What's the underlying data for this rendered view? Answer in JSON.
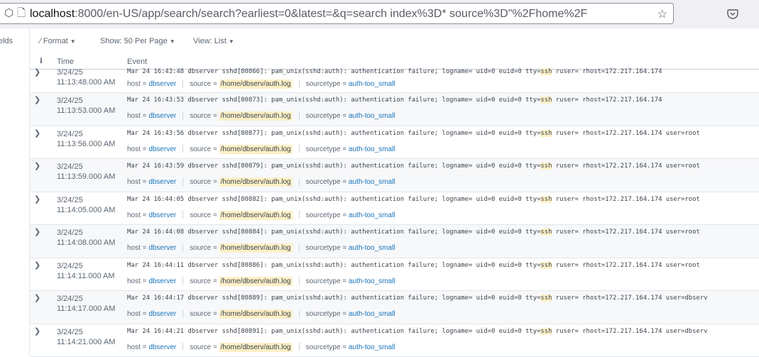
{
  "browser": {
    "url_host": "localhost",
    "url_rest": ":8000/en-US/app/search/search?earliest=0&latest=&q=search index%3D* source%3D\"%2Fhome%2F",
    "icons": [
      "shield-icon",
      "page-icon",
      "star-icon",
      "pocket-icon"
    ]
  },
  "toolbar": {
    "fields_label": "elds",
    "format_label": "Format",
    "show_label": "Show: 50 Per Page",
    "view_label": "View: List"
  },
  "table": {
    "col_info": "i",
    "col_time": "Time",
    "col_event": "Event",
    "field_keys": {
      "host": "host =",
      "source": "source =",
      "sourcetype": "sourcetype ="
    },
    "rows": [
      {
        "date": "3/24/25",
        "time": "11:13:48.000 AM",
        "pre": "Mar 24 16:43:48 dbserver sshd[80866]: pam_unix(sshd:auth): authentication failure; logname= uid=0 euid=0 tty=",
        "hl": "ssh",
        "post": " ruser= rhost=172.217.164.174",
        "host": "dbserver",
        "source": "/home/dbserv/auth.log",
        "sourcetype": "auth-too_small"
      },
      {
        "date": "3/24/25",
        "time": "11:13:53.000 AM",
        "pre": "Mar 24 16:43:53 dbserver sshd[80873]: pam_unix(sshd:auth): authentication failure; logname= uid=0 euid=0 tty=",
        "hl": "ssh",
        "post": " ruser= rhost=172.217.164.174",
        "host": "dbserver",
        "source": "/home/dbserv/auth.log",
        "sourcetype": "auth-too_small"
      },
      {
        "date": "3/24/25",
        "time": "11:13:56.000 AM",
        "pre": "Mar 24 16:43:56 dbserver sshd[80877]: pam_unix(sshd:auth): authentication failure; logname= uid=0 euid=0 tty=",
        "hl": "ssh",
        "post": " ruser= rhost=172.217.164.174  user=root",
        "host": "dbserver",
        "source": "/home/dbserv/auth.log",
        "sourcetype": "auth-too_small"
      },
      {
        "date": "3/24/25",
        "time": "11:13:59.000 AM",
        "pre": "Mar 24 16:43:59 dbserver sshd[80879]: pam_unix(sshd:auth): authentication failure; logname= uid=0 euid=0 tty=",
        "hl": "ssh",
        "post": " ruser= rhost=172.217.164.174  user=root",
        "host": "dbserver",
        "source": "/home/dbserv/auth.log",
        "sourcetype": "auth-too_small"
      },
      {
        "date": "3/24/25",
        "time": "11:14:05.000 AM",
        "pre": "Mar 24 16:44:05 dbserver sshd[80882]: pam_unix(sshd:auth): authentication failure; logname= uid=0 euid=0 tty=",
        "hl": "ssh",
        "post": " ruser= rhost=172.217.164.174  user=root",
        "host": "dbserver",
        "source": "/home/dbserv/auth.log",
        "sourcetype": "auth-too_small"
      },
      {
        "date": "3/24/25",
        "time": "11:14:08.000 AM",
        "pre": "Mar 24 16:44:08 dbserver sshd[80884]: pam_unix(sshd:auth): authentication failure; logname= uid=0 euid=0 tty=",
        "hl": "ssh",
        "post": " ruser= rhost=172.217.164.174  user=root",
        "host": "dbserver",
        "source": "/home/dbserv/auth.log",
        "sourcetype": "auth-too_small"
      },
      {
        "date": "3/24/25",
        "time": "11:14:11.000 AM",
        "pre": "Mar 24 16:44:11 dbserver sshd[80886]: pam_unix(sshd:auth): authentication failure; logname= uid=0 euid=0 tty=",
        "hl": "ssh",
        "post": " ruser= rhost=172.217.164.174  user=root",
        "host": "dbserver",
        "source": "/home/dbserv/auth.log",
        "sourcetype": "auth-too_small"
      },
      {
        "date": "3/24/25",
        "time": "11:14:17.000 AM",
        "pre": "Mar 24 16:44:17 dbserver sshd[80889]: pam_unix(sshd:auth): authentication failure; logname= uid=0 euid=0 tty=",
        "hl": "ssh",
        "post": " ruser= rhost=172.217.164.174  user=dbserv",
        "host": "dbserver",
        "source": "/home/dbserv/auth.log",
        "sourcetype": "auth-too_small"
      },
      {
        "date": "3/24/25",
        "time": "11:14:21.000 AM",
        "pre": "Mar 24 16:44:21 dbserver sshd[80891]: pam_unix(sshd:auth): authentication failure; logname= uid=0 euid=0 tty=",
        "hl": "ssh",
        "post": " ruser= rhost=172.217.164.174  user=dbserv",
        "host": "dbserver",
        "source": "/home/dbserv/auth.log",
        "sourcetype": "auth-too_small"
      }
    ]
  }
}
